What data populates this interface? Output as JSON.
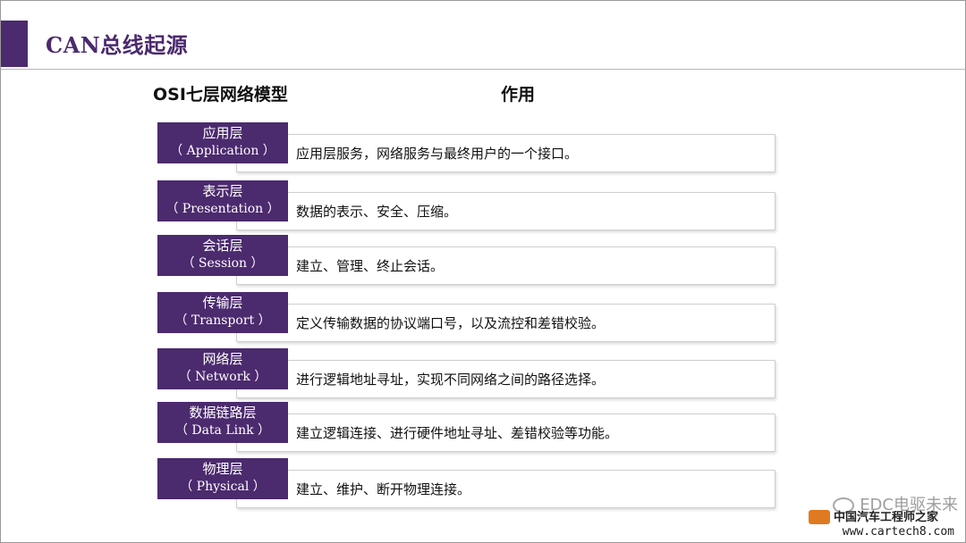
{
  "slide": {
    "title": "CAN总线起源",
    "header_left": "OSI七层网络模型",
    "header_right": "作用"
  },
  "layers": [
    {
      "name_cn": "应用层",
      "name_en": "（ Application ）",
      "description": "应用层服务，网络服务与最终用户的一个接口。"
    },
    {
      "name_cn": "表示层",
      "name_en": "（ Presentation ）",
      "description": "数据的表示、安全、压缩。"
    },
    {
      "name_cn": "会话层",
      "name_en": "（ Session ）",
      "description": "建立、管理、终止会话。"
    },
    {
      "name_cn": "传输层",
      "name_en": "（ Transport ）",
      "description": "定义传输数据的协议端口号，以及流控和差错校验。"
    },
    {
      "name_cn": "网络层",
      "name_en": "（ Network ）",
      "description": "进行逻辑地址寻址，实现不同网络之间的路径选择。"
    },
    {
      "name_cn": "数据链路层",
      "name_en": "（ Data Link ）",
      "description": "建立逻辑连接、进行硬件地址寻址、差错校验等功能。"
    },
    {
      "name_cn": "物理层",
      "name_en": "（ Physical ）",
      "description": "建立、维护、断开物理连接。"
    }
  ],
  "watermark": {
    "account": "EDC电驱未来",
    "site_cn": "中国汽车工程师之家",
    "site_url": "www.cartech8.com"
  },
  "colors": {
    "accent": "#4b2a6e",
    "rule": "#b9b2c4",
    "box_border": "#cfcfcf"
  }
}
